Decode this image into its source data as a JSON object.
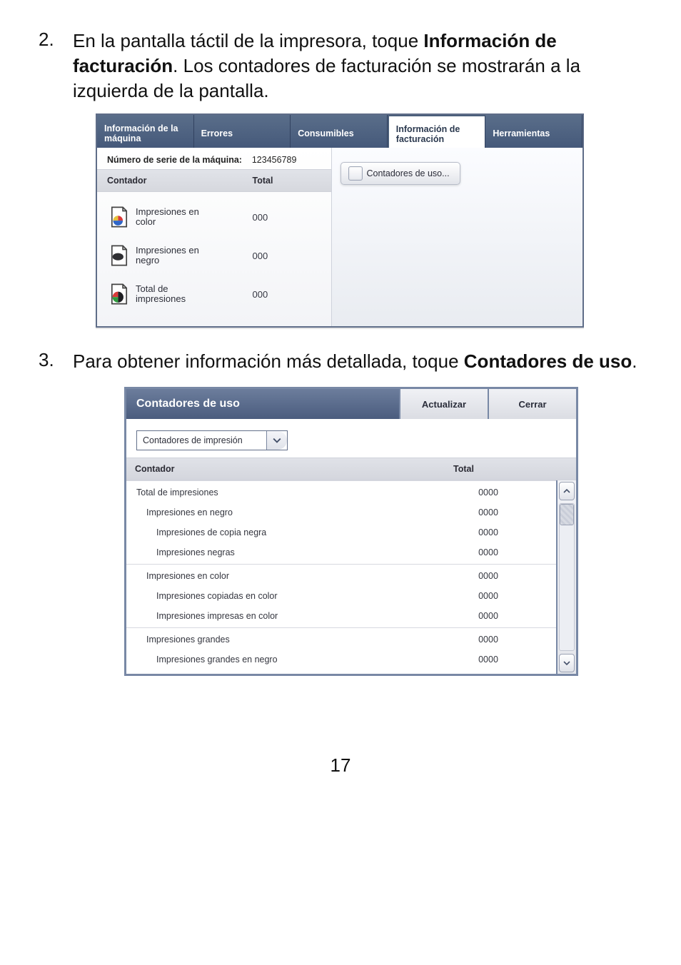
{
  "steps": {
    "s2": {
      "num": "2.",
      "pre": "En la pantalla táctil de la impresora, toque ",
      "bold": "Información de facturación",
      "post": ". Los contadores de facturación se mostrarán a la izquierda de la pantalla."
    },
    "s3": {
      "num": "3.",
      "pre": "Para obtener información más detallada, toque ",
      "bold": "Contadores de uso",
      "post": "."
    }
  },
  "shot1": {
    "tabs": {
      "machine_info": "Información de la máquina",
      "errors": "Errores",
      "consumables": "Consumibles",
      "billing_info": "Información de facturación",
      "tools": "Herramientas"
    },
    "serial_label": "Número de serie de la máquina:",
    "serial_value": "123456789",
    "col_counter": "Contador",
    "col_total": "Total",
    "rows": {
      "color": {
        "label_l1": "Impresiones en",
        "label_l2": "color",
        "total": "000"
      },
      "black": {
        "label_l1": "Impresiones en",
        "label_l2": "negro",
        "total": "000"
      },
      "total": {
        "label_l1": "Total de",
        "label_l2": "impresiones",
        "total": "000"
      }
    },
    "usage_button": "Contadores de uso..."
  },
  "shot2": {
    "title": "Contadores de uso",
    "actualizar": "Actualizar",
    "cerrar": "Cerrar",
    "dropdown": "Contadores de impresión",
    "col_counter": "Contador",
    "col_total": "Total",
    "rows": [
      {
        "label": "Total de impresiones",
        "value": "0000",
        "indent": 1,
        "sep": false
      },
      {
        "label": "Impresiones en negro",
        "value": "0000",
        "indent": 2,
        "sep": false
      },
      {
        "label": "Impresiones de copia negra",
        "value": "0000",
        "indent": 3,
        "sep": false
      },
      {
        "label": "Impresiones negras",
        "value": "0000",
        "indent": 3,
        "sep": true
      },
      {
        "label": "Impresiones en color",
        "value": "0000",
        "indent": 2,
        "sep": false
      },
      {
        "label": "Impresiones copiadas en color",
        "value": "0000",
        "indent": 3,
        "sep": false
      },
      {
        "label": "Impresiones impresas en color",
        "value": "0000",
        "indent": 3,
        "sep": true
      },
      {
        "label": "Impresiones grandes",
        "value": "0000",
        "indent": 2,
        "sep": false
      },
      {
        "label": "Impresiones grandes en negro",
        "value": "0000",
        "indent": 3,
        "sep": false
      }
    ]
  },
  "page_number": "17"
}
